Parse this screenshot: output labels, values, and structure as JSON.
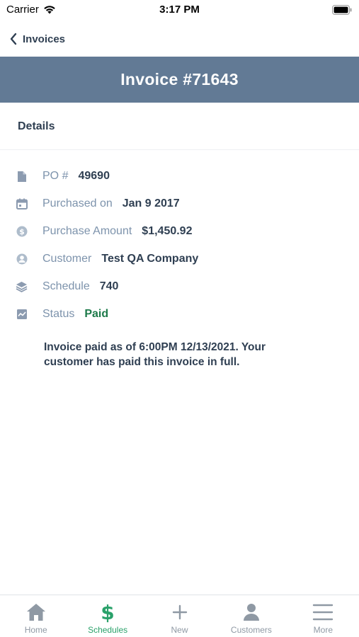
{
  "status_bar": {
    "carrier": "Carrier",
    "time": "3:17 PM"
  },
  "nav": {
    "back_label": "Invoices"
  },
  "header": {
    "title": "Invoice #71643"
  },
  "section": {
    "title": "Details"
  },
  "details": [
    {
      "label": "PO #",
      "value": "49690",
      "icon": "document-icon"
    },
    {
      "label": "Purchased on",
      "value": "Jan  9 2017",
      "icon": "calendar-icon"
    },
    {
      "label": "Purchase Amount",
      "value": "$1,450.92",
      "icon": "dollar-coin-icon"
    },
    {
      "label": "Customer",
      "value": "Test QA Company",
      "icon": "user-circle-icon"
    },
    {
      "label": "Schedule",
      "value": "740",
      "icon": "layers-icon"
    },
    {
      "label": "Status",
      "value": "Paid",
      "icon": "chart-line-icon"
    }
  ],
  "status_note": "Invoice paid as of 6:00PM 12/13/2021. Your customer has paid this invoice in full.",
  "colors": {
    "header": "#627a95",
    "label": "#7d93ac",
    "value": "#2f3f52",
    "paid": "#1d7a4a",
    "active_tab": "#2aa16a",
    "inactive_tab": "#8f99a4"
  },
  "tabs": [
    {
      "label": "Home",
      "icon": "home-icon",
      "active": false
    },
    {
      "label": "Schedules",
      "icon": "dollar-icon",
      "active": true
    },
    {
      "label": "New",
      "icon": "plus-icon",
      "active": false
    },
    {
      "label": "Customers",
      "icon": "person-icon",
      "active": false
    },
    {
      "label": "More",
      "icon": "menu-icon",
      "active": false
    }
  ]
}
